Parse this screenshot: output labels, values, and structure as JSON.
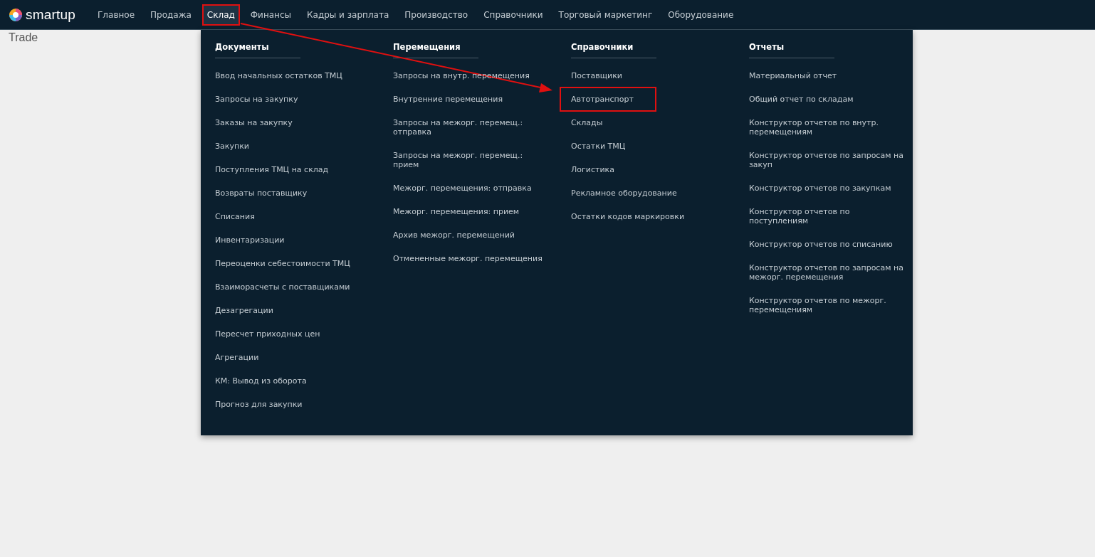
{
  "logo": {
    "text": "smartup"
  },
  "nav": [
    {
      "label": "Главное",
      "selected": false,
      "highlighted": false
    },
    {
      "label": "Продажа",
      "selected": false,
      "highlighted": false
    },
    {
      "label": "Склад",
      "selected": true,
      "highlighted": true
    },
    {
      "label": "Финансы",
      "selected": false,
      "highlighted": false
    },
    {
      "label": "Кадры и зарплата",
      "selected": false,
      "highlighted": false
    },
    {
      "label": "Производство",
      "selected": false,
      "highlighted": false
    },
    {
      "label": "Справочники",
      "selected": false,
      "highlighted": false
    },
    {
      "label": "Торговый маркетинг",
      "selected": false,
      "highlighted": false
    },
    {
      "label": "Оборудование",
      "selected": false,
      "highlighted": false
    }
  ],
  "page_title": "Trade",
  "menu": {
    "columns": [
      {
        "heading": "Документы",
        "items": [
          {
            "label": "Ввод начальных остатков ТМЦ",
            "highlighted": false
          },
          {
            "label": "Запросы на закупку",
            "highlighted": false
          },
          {
            "label": "Заказы на закупку",
            "highlighted": false
          },
          {
            "label": "Закупки",
            "highlighted": false
          },
          {
            "label": "Поступления ТМЦ на склад",
            "highlighted": false
          },
          {
            "label": "Возвраты поставщику",
            "highlighted": false
          },
          {
            "label": "Списания",
            "highlighted": false
          },
          {
            "label": "Инвентаризации",
            "highlighted": false
          },
          {
            "label": "Переоценки себестоимости ТМЦ",
            "highlighted": false
          },
          {
            "label": "Взаиморасчеты с поставщиками",
            "highlighted": false
          },
          {
            "label": "Дезагрегации",
            "highlighted": false
          },
          {
            "label": "Пересчет приходных цен",
            "highlighted": false
          },
          {
            "label": "Агрегации",
            "highlighted": false
          },
          {
            "label": "КМ: Вывод из оборота",
            "highlighted": false
          },
          {
            "label": "Прогноз для закупки",
            "highlighted": false
          }
        ]
      },
      {
        "heading": "Перемещения",
        "items": [
          {
            "label": "Запросы на внутр. перемещения",
            "highlighted": false
          },
          {
            "label": "Внутренние перемещения",
            "highlighted": false
          },
          {
            "label": "Запросы на межорг. перемещ.: отправка",
            "highlighted": false
          },
          {
            "label": "Запросы на межорг. перемещ.: прием",
            "highlighted": false
          },
          {
            "label": "Межорг. перемещения: отправка",
            "highlighted": false
          },
          {
            "label": "Межорг. перемещения: прием",
            "highlighted": false
          },
          {
            "label": "Архив межорг. перемещений",
            "highlighted": false
          },
          {
            "label": "Отмененные межорг. перемещения",
            "highlighted": false
          }
        ]
      },
      {
        "heading": "Справочники",
        "items": [
          {
            "label": "Поставщики",
            "highlighted": false
          },
          {
            "label": "Автотранспорт",
            "highlighted": true
          },
          {
            "label": "Склады",
            "highlighted": false
          },
          {
            "label": "Остатки ТМЦ",
            "highlighted": false
          },
          {
            "label": "Логистика",
            "highlighted": false
          },
          {
            "label": "Рекламное оборудование",
            "highlighted": false
          },
          {
            "label": "Остатки кодов маркировки",
            "highlighted": false
          }
        ]
      },
      {
        "heading": "Отчеты",
        "items": [
          {
            "label": "Материальный отчет",
            "highlighted": false
          },
          {
            "label": "Общий отчет по складам",
            "highlighted": false
          },
          {
            "label": "Конструктор отчетов по внутр. перемещениям",
            "highlighted": false
          },
          {
            "label": "Конструктор отчетов по запросам на закуп",
            "highlighted": false
          },
          {
            "label": "Конструктор отчетов по закупкам",
            "highlighted": false
          },
          {
            "label": "Конструктор отчетов по поступлениям",
            "highlighted": false
          },
          {
            "label": "Конструктор отчетов по списанию",
            "highlighted": false
          },
          {
            "label": "Конструктор отчетов по запросам на межорг. перемещения",
            "highlighted": false
          },
          {
            "label": "Конструктор отчетов по межорг. перемещениям",
            "highlighted": false
          }
        ]
      }
    ]
  }
}
